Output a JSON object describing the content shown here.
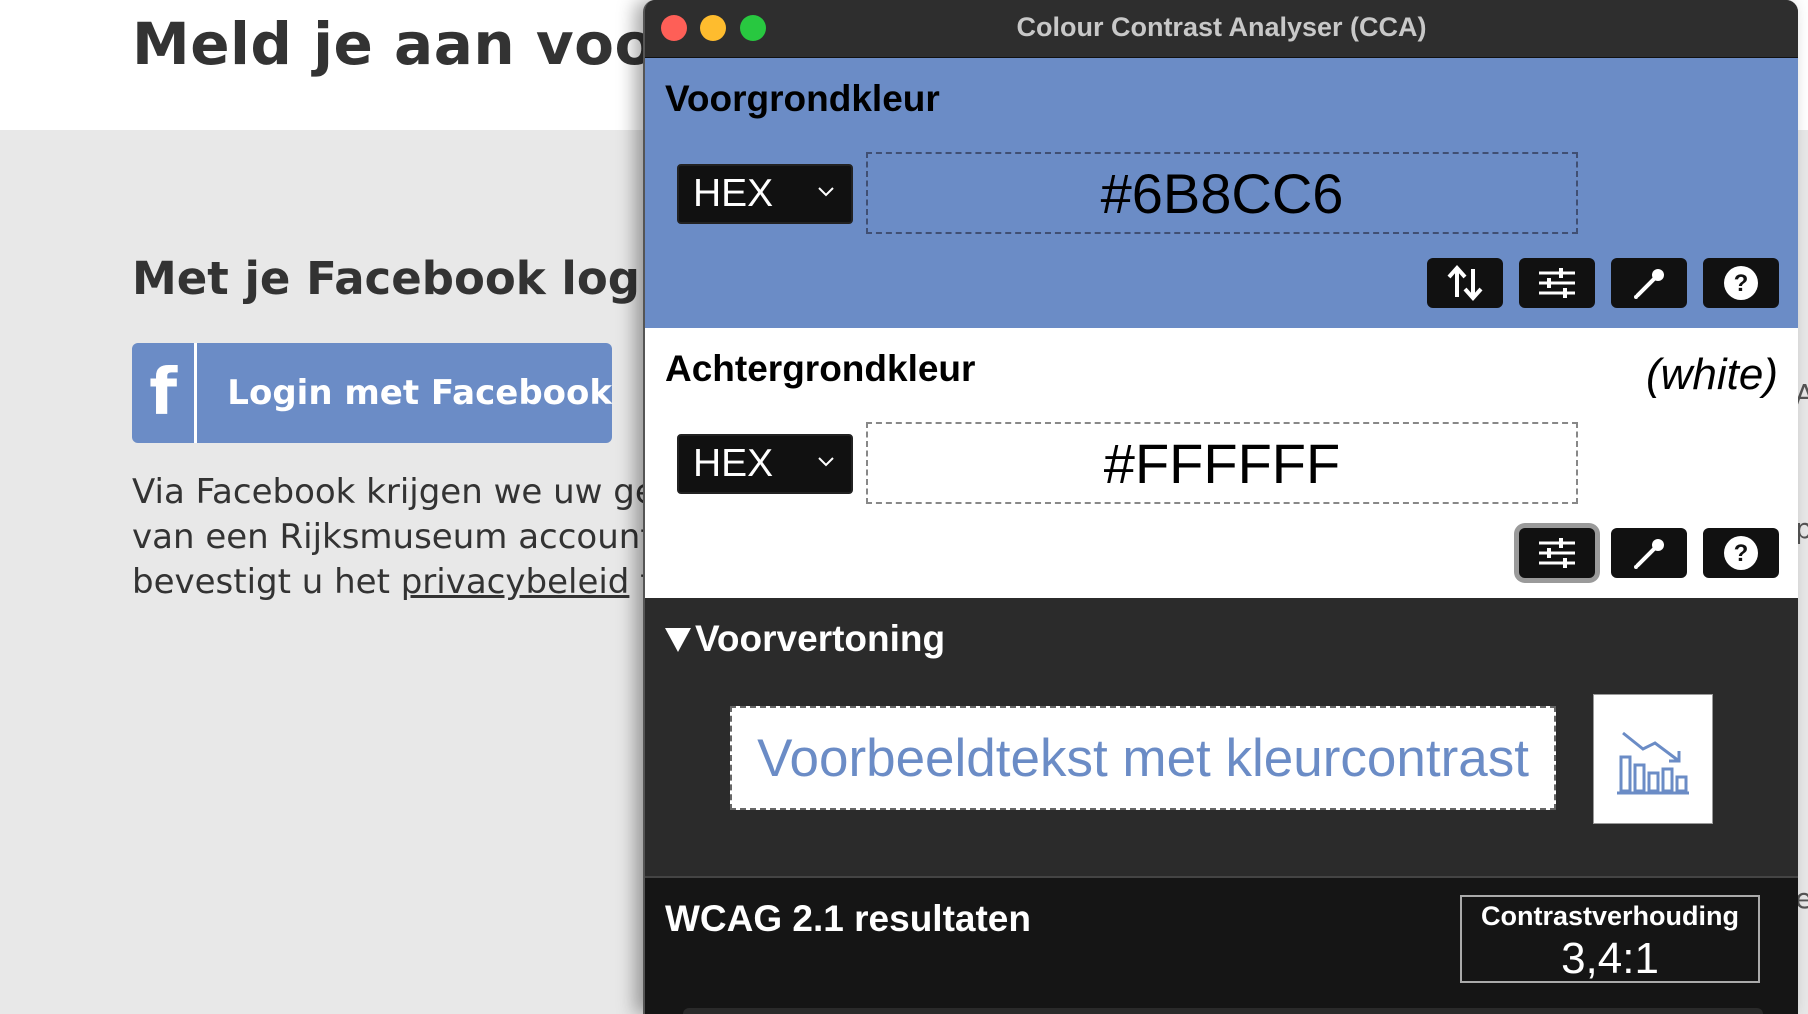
{
  "background_page": {
    "title": "Meld je aan voor je",
    "subtitle": "Met je Facebook login",
    "facebook_button": {
      "icon": "f",
      "label": "Login met Facebook"
    },
    "paragraph": {
      "line1": "Via Facebook krijgen we uw gege",
      "line2": "van een Rijksmuseum account. D",
      "line3_before": "bevestigt u het ",
      "line3_link": "privacybeleid",
      "line3_after": " te h"
    },
    "right_fragments": [
      "A",
      "p",
      "e"
    ]
  },
  "window": {
    "title": "Colour Contrast Analyser (CCA)"
  },
  "foreground": {
    "heading": "Voorgrondkleur",
    "format": "HEX",
    "value": "#6B8CC6",
    "color": "#6B8CC6"
  },
  "background": {
    "heading": "Achtergrondkleur",
    "color_name": "(white)",
    "format": "HEX",
    "value": "#FFFFFF",
    "color": "#FFFFFF"
  },
  "preview": {
    "heading": "Voorvertoning",
    "sample_text": "Voorbeeldtekst met kleurcontrast"
  },
  "results": {
    "heading": "WCAG 2.1 resultaten",
    "ratio_label": "Contrastverhouding",
    "ratio_value": "3,4:1"
  },
  "icons": {
    "swap": "swap-icon",
    "sliders": "sliders-icon",
    "eyedropper": "eyedropper-icon",
    "help": "help-icon",
    "chart": "chart-icon",
    "chevron": "chevron-down-icon"
  }
}
